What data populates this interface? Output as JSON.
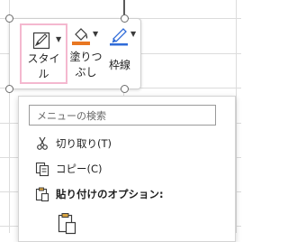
{
  "toolbar": {
    "style_line1": "スタイ",
    "style_line2": "ル",
    "fill_line1": "塗りつ",
    "fill_line2": "ぶし",
    "border_label": "枠線"
  },
  "context_menu": {
    "search_placeholder": "メニューの検索",
    "items": [
      {
        "label": "切り取り(T)",
        "icon": "scissors-icon"
      },
      {
        "label": "コピー(C)",
        "icon": "copy-icon"
      },
      {
        "label": "貼り付けのオプション:",
        "icon": "paste-icon"
      }
    ]
  },
  "colors": {
    "style_highlight": "#f4b8cf",
    "fill_color_bar": "#e87722",
    "border_accent": "#2f6bd8"
  }
}
